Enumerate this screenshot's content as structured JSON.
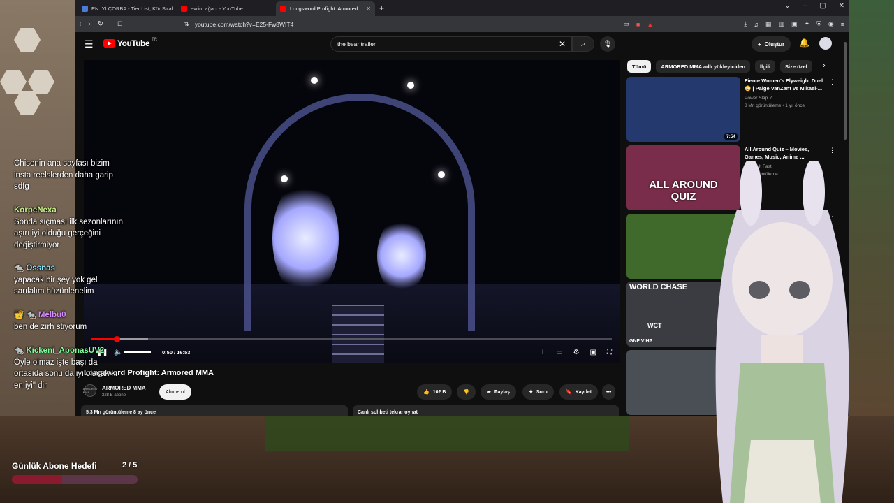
{
  "browser": {
    "tabs": [
      {
        "title": "EN İYİ ÇORBA - Tier List, Kör Sıralama",
        "active": false,
        "color": "#4a7bd6"
      },
      {
        "title": "evrim ağacı - YouTube",
        "active": false,
        "color": "#ff0000"
      },
      {
        "title": "Longsword Profight: Armored",
        "active": true,
        "color": "#ff0000"
      }
    ],
    "url": "youtube.com/watch?v=E25-Fw8WIT4"
  },
  "youtube": {
    "logo_text": "YouTube",
    "country": "TR",
    "search_value": "the bear trailer",
    "create_label": "Oluştur",
    "player": {
      "time": "0:50 / 16:53",
      "played_fraction": 0.05,
      "loaded_fraction": 0.11
    },
    "video": {
      "title": "Longsword Profight: Armored MMA",
      "channel_name": "ARMORED MMA",
      "channel_subs": "228 B abone",
      "channel_avatar_text": "ARMORED MMA",
      "subscribe_label": "Abone ol",
      "likes": "102 B",
      "share_label": "Paylaş",
      "ask_label": "Soru",
      "save_label": "Kaydet",
      "info": "5,3 Mn görüntüleme  8 ay önce",
      "chat_replay": "Canlı sohbeti tekrar oynat"
    },
    "chips": [
      "Tümü",
      "ARMORED MMA adlı yükleyiciden",
      "İlgili",
      "Size özel"
    ],
    "recommendations": [
      {
        "title": "Fierce Women's Flyweight Duel 😳 | Paige VanZant vs Mikael-...",
        "channel": "Power Slap ✓",
        "meta": "8 Mn görüntüleme • 1 yıl önce",
        "duration": "7:54",
        "thumb": "#243a6e"
      },
      {
        "title": "All Around Quiz – Movies, Games, Music, Anime ...",
        "channel": "Guess It Fast",
        "meta": "3 B görüntüleme",
        "duration": "",
        "thumb": "#7a2d4a"
      },
      {
        "title": "",
        "channel": "",
        "meta": "",
        "duration": "",
        "thumb": "#3f6a2c"
      },
      {
        "title": "",
        "channel": "",
        "meta": "",
        "duration": "",
        "thumb": "#3b3b42"
      },
      {
        "title": "",
        "channel": "",
        "meta": "",
        "duration": "",
        "thumb": "#4a4e55"
      }
    ],
    "thumb_text": {
      "quiz_line1": "ALL AROUND",
      "quiz_line2": "QUIZ",
      "world_chase": "WORLD CHASE",
      "wct": "WCT",
      "gnf": "GNF V HP"
    }
  },
  "chat": [
    {
      "user": "",
      "badge": "",
      "user_color": "#ffffff",
      "lines": [
        "Chisenin ana sayfası bizim",
        "insta reelslerden daha garip",
        "sdfg"
      ]
    },
    {
      "user": "KorpeNexa",
      "badge": "",
      "user_color": "#c8f08a",
      "lines": [
        "Sonda sıçması ilk sezonlarının",
        "aşırı iyi olduğu gerçeğini",
        "değiştirmiyor"
      ]
    },
    {
      "user": "Ossnas",
      "badge": "🐀",
      "user_color": "#8ee6ff",
      "lines": [
        "yapacak bir şey yok gel",
        "sarılalım hüzünlenelim"
      ]
    },
    {
      "user": "Melbu0",
      "badge": "👑 🐀",
      "user_color": "#d68cff",
      "lines": [
        "ben de zırh stiyorum"
      ]
    },
    {
      "user": "Kickeni_AponasUV2",
      "badge": "🐀",
      "user_color": "#7dff9a",
      "lines": [
        "Öyle olmaz işte başı da",
        "ortasıda sonu da iyi olacak ki",
        "en iyi\" dir"
      ]
    }
  ],
  "goal": {
    "label": "Günlük Abone Hedefi",
    "count": "2 / 5",
    "fraction": 0.4
  }
}
